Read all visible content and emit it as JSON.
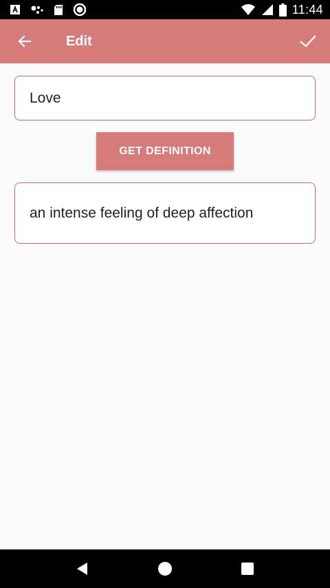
{
  "status_bar": {
    "time": "11:44",
    "left_icons": [
      "accessibility-a-icon",
      "assistant-dots-icon",
      "sd-card-icon",
      "sync-circle-icon"
    ],
    "right_icons": [
      "wifi-icon",
      "signal-icon",
      "battery-icon"
    ]
  },
  "app_bar": {
    "title": "Edit",
    "back_icon": "arrow-back-icon",
    "confirm_icon": "check-icon",
    "color": "#d67a7a"
  },
  "form": {
    "word_value": "Love",
    "button_label": "GET DEFINITION",
    "definition_value": "an intense feeling of deep affection",
    "border_color": "#d06a6a"
  },
  "nav_bar": {
    "icons": [
      "back-triangle-icon",
      "home-circle-icon",
      "recents-square-icon"
    ]
  }
}
